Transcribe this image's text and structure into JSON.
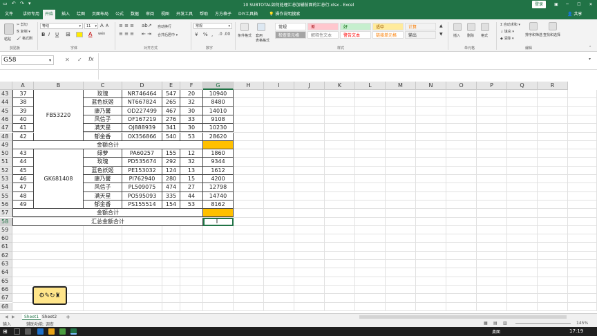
{
  "titlebar": {
    "quick": "▭ ↶ ↷ ▾",
    "title": "10 SUBTOTAL如何处理汇总加辅前面的汇总行.xlsx - Excel",
    "login": "登录",
    "minimize": "─",
    "restore": "☐",
    "close": "✕"
  },
  "menu": [
    "文件",
    "讲师专用",
    "开始",
    "插入",
    "绘图",
    "页面布局",
    "公式",
    "数据",
    "审阅",
    "视图",
    "开发工具",
    "帮助",
    "方方格子",
    "DIY工具箱",
    "操作说明搜索"
  ],
  "menu_right": {
    "share": "共享"
  },
  "ribbon": {
    "clipboard": {
      "paste": "粘贴",
      "cut": "剪切",
      "copy": "复制 ▾",
      "painter": "格式刷",
      "label": "剪贴板"
    },
    "font": {
      "name": "等线",
      "size": "11",
      "grow": "A",
      "shrink": "A",
      "label": "字体",
      "bold": "B",
      "italic": "I",
      "underline": "U",
      "fontcolor": "A",
      "wen": "wén"
    },
    "align": {
      "wrap": "自动换行",
      "merge": "合并后居中 ▾",
      "label": "对齐方式"
    },
    "number": {
      "format": "常规",
      "label": "数字",
      "percent": "%",
      "comma": ","
    },
    "styles": {
      "cond": "条件格式",
      "table": "套用\n表格格式",
      "label": "样式",
      "cells": [
        {
          "t": "常规",
          "bg": "#ffffff",
          "c": "#333333"
        },
        {
          "t": "差",
          "bg": "#ffc7ce",
          "c": "#9c0006"
        },
        {
          "t": "好",
          "bg": "#c6efce",
          "c": "#006100"
        },
        {
          "t": "适中",
          "bg": "#ffeb9c",
          "c": "#9c5700"
        },
        {
          "t": "计算",
          "bg": "#f2f2f2",
          "c": "#fa7d00"
        },
        {
          "t": "检查单元格",
          "bg": "#a5a5a5",
          "c": "#ffffff"
        },
        {
          "t": "解释性文本",
          "bg": "#ffffff",
          "c": "#7f7f7f"
        },
        {
          "t": "警告文本",
          "bg": "#ffffff",
          "c": "#ff0000"
        },
        {
          "t": "链接单元格",
          "bg": "#ffffff",
          "c": "#fa7d00"
        },
        {
          "t": "输出",
          "bg": "#f2f2f2",
          "c": "#3f3f3f"
        }
      ]
    },
    "cells": {
      "insert": "插入",
      "delete": "删除",
      "format": "格式",
      "label": "单元格"
    },
    "edit": {
      "autosum": "Σ 自动求和 ▾",
      "fill": "↓ 填充 ▾",
      "clear": "◆ 清除 ▾",
      "sort": "排序和筛选",
      "find": "查找和选择",
      "label": "编辑"
    }
  },
  "formula": {
    "namebox": "G58",
    "cancel": "✕",
    "enter": "✓",
    "fx": "fx",
    "value": ""
  },
  "columns": [
    "A",
    "B",
    "C",
    "D",
    "E",
    "F",
    "G",
    "H",
    "I",
    "J",
    "K",
    "L",
    "M",
    "N",
    "O",
    "P",
    "Q",
    "R"
  ],
  "rows": [
    {
      "n": "43",
      "a": "37",
      "c": "玫瑰",
      "d": "NR746464",
      "e": "547",
      "f": "20",
      "g": "10940"
    },
    {
      "n": "44",
      "a": "38",
      "c": "蓝色妖姬",
      "d": "NT667824",
      "e": "265",
      "f": "32",
      "g": "8480"
    },
    {
      "n": "45",
      "a": "39",
      "c": "康乃馨",
      "d": "OD227499",
      "e": "467",
      "f": "30",
      "g": "14010"
    },
    {
      "n": "46",
      "a": "40",
      "c": "风信子",
      "d": "OF167219",
      "e": "276",
      "f": "33",
      "g": "9108"
    },
    {
      "n": "47",
      "a": "41",
      "c": "满天星",
      "d": "OJ888939",
      "e": "341",
      "f": "30",
      "g": "10230"
    },
    {
      "n": "48",
      "a": "42",
      "c": "郁金香",
      "d": "OX356866",
      "e": "540",
      "f": "53",
      "g": "28620"
    },
    {
      "n": "49",
      "a": "",
      "c": "金额合计",
      "d": "",
      "e": "",
      "f": "",
      "g": ""
    },
    {
      "n": "50",
      "a": "43",
      "c": "绿萝",
      "d": "PA60257",
      "e": "155",
      "f": "12",
      "g": "1860"
    },
    {
      "n": "51",
      "a": "44",
      "c": "玫瑰",
      "d": "PD535674",
      "e": "292",
      "f": "32",
      "g": "9344"
    },
    {
      "n": "52",
      "a": "45",
      "c": "蓝色妖姬",
      "d": "PE153032",
      "e": "124",
      "f": "13",
      "g": "1612"
    },
    {
      "n": "53",
      "a": "46",
      "c": "康乃馨",
      "d": "PI762940",
      "e": "280",
      "f": "15",
      "g": "4200"
    },
    {
      "n": "54",
      "a": "47",
      "c": "风信子",
      "d": "PL509075",
      "e": "474",
      "f": "27",
      "g": "12798"
    },
    {
      "n": "55",
      "a": "48",
      "c": "满天星",
      "d": "PO595093",
      "e": "335",
      "f": "44",
      "g": "14740"
    },
    {
      "n": "56",
      "a": "49",
      "c": "郁金香",
      "d": "PS155514",
      "e": "154",
      "f": "53",
      "g": "8162"
    },
    {
      "n": "57",
      "a": "",
      "c": "金额合计",
      "d": "",
      "e": "",
      "f": "",
      "g": ""
    },
    {
      "n": "58",
      "a": "",
      "c": "汇总金额合计",
      "d": "",
      "e": "",
      "f": "",
      "g": ""
    },
    {
      "n": "59"
    },
    {
      "n": "60"
    },
    {
      "n": "61"
    },
    {
      "n": "62"
    },
    {
      "n": "63"
    },
    {
      "n": "64"
    },
    {
      "n": "65"
    },
    {
      "n": "66"
    },
    {
      "n": "67"
    },
    {
      "n": "68"
    }
  ],
  "groups": [
    {
      "id": "FB53220"
    },
    {
      "id": "GK681408"
    }
  ],
  "sheets": [
    "Sheet1",
    "Sheet2"
  ],
  "sheet_add": "+",
  "status": {
    "mode": "输入",
    "access": "辅助功能: 调查",
    "zoom": "145%"
  },
  "colors": {
    "accent": "#217346",
    "highlight": "#ffc000"
  },
  "taskbar": {
    "time": "17:19",
    "desk": "桌面"
  }
}
